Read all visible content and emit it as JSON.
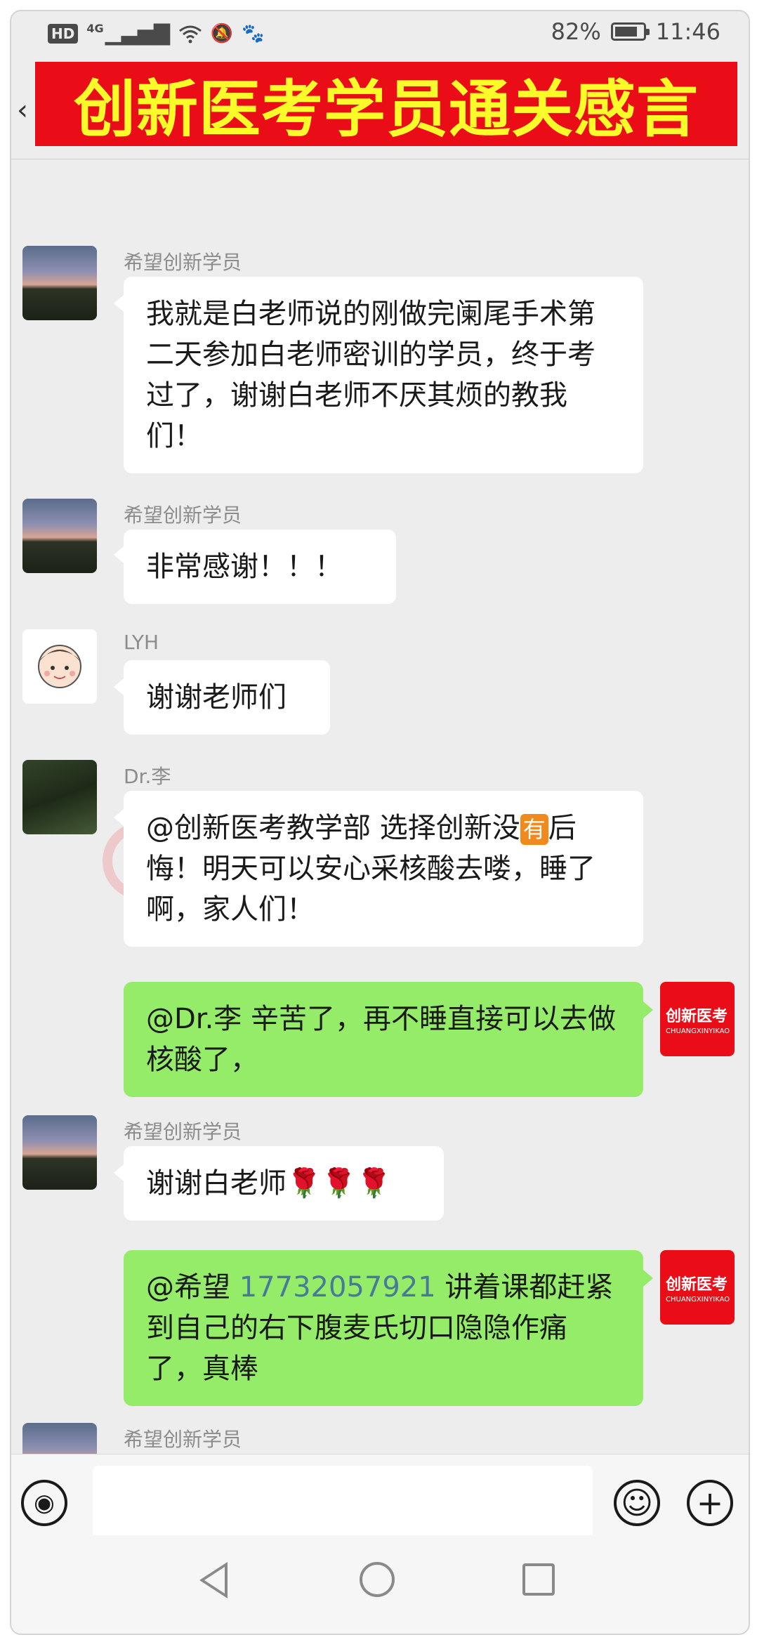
{
  "status_bar": {
    "hd": "HD",
    "network": "4G",
    "signal_icon": "▁▃▅▇",
    "wifi_icon": "wifi-icon",
    "mute_icon": "🔕",
    "app_icon": "🐾",
    "battery": "82%",
    "time": "11:46"
  },
  "banner": {
    "title": "创新医考学员通关感言",
    "bg": "#ea0d18",
    "fg": "#fbfb2a"
  },
  "back_icon": "‹",
  "messages": [
    {
      "sender": "希望创新学员",
      "text": "我就是白老师说的刚做完阑尾手术第二天参加白老师密训的学员，终于考过了，谢谢白老师不厌其烦的教我们！"
    },
    {
      "sender": "希望创新学员",
      "text": "非常感谢！！！"
    },
    {
      "sender": "LYH",
      "text": "谢谢老师们"
    },
    {
      "sender": "Dr.李",
      "text_before": "@创新医考教学部 选择创新没",
      "badge": "有",
      "text_after": "后悔！明天可以安心采核酸去喽，睡了啊，家人们！"
    },
    {
      "text": "@Dr.李  辛苦了，再不睡直接可以去做核酸了，"
    },
    {
      "sender": "希望创新学员",
      "text": "谢谢白老师🌹🌹🌹"
    },
    {
      "text_before": "@希望 ",
      "link": "17732057921",
      "text_after": " 讲着课都赶紧到自己的右下腹麦氏切口隐隐作痛了，真棒"
    },
    {
      "sender": "希望创新学员"
    }
  ],
  "brand_avatar": {
    "name": "创新医考",
    "sub": "CHUANGXINYIKAO"
  },
  "watermark": {
    "text": "创新医考"
  },
  "input_bar": {
    "voice_icon": "◉",
    "emoji_icon": "☺",
    "add_icon": "+"
  },
  "colors": {
    "outgoing": "#95ec69",
    "incoming": "#ffffff",
    "chat_bg": "#ededed",
    "link": "#46799a"
  }
}
